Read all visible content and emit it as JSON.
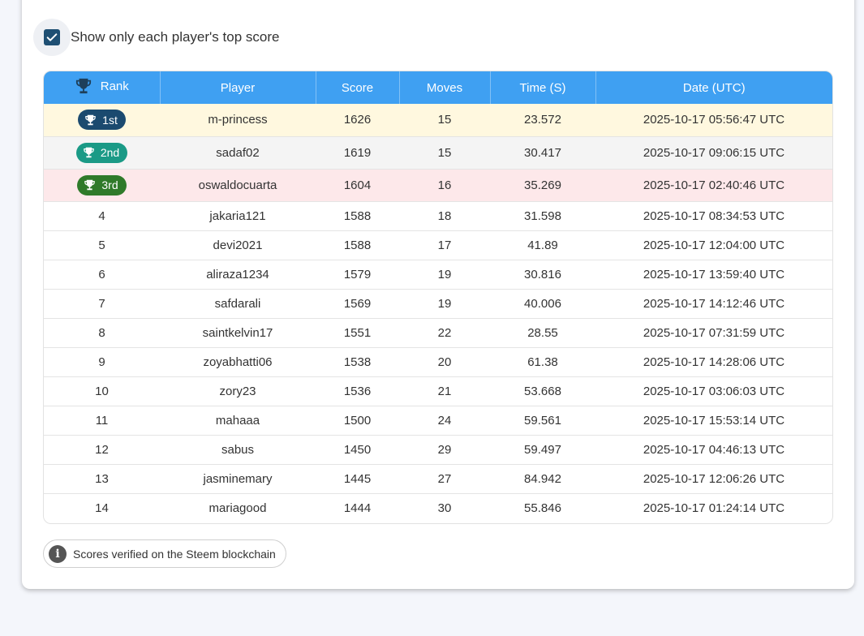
{
  "filter": {
    "top_score_only_label": "Show only each player's top score",
    "checked": true
  },
  "table": {
    "headers": [
      "Rank",
      "Player",
      "Score",
      "Moves",
      "Time (S)",
      "Date (UTC)"
    ],
    "rows": [
      {
        "rank": "1st",
        "player": "m-princess",
        "score": "1626",
        "moves": "15",
        "time": "23.572",
        "date": "2025-10-17 05:56:47 UTC"
      },
      {
        "rank": "2nd",
        "player": "sadaf02",
        "score": "1619",
        "moves": "15",
        "time": "30.417",
        "date": "2025-10-17 09:06:15 UTC"
      },
      {
        "rank": "3rd",
        "player": "oswaldocuarta",
        "score": "1604",
        "moves": "16",
        "time": "35.269",
        "date": "2025-10-17 02:40:46 UTC"
      },
      {
        "rank": "4",
        "player": "jakaria121",
        "score": "1588",
        "moves": "18",
        "time": "31.598",
        "date": "2025-10-17 08:34:53 UTC"
      },
      {
        "rank": "5",
        "player": "devi2021",
        "score": "1588",
        "moves": "17",
        "time": "41.89",
        "date": "2025-10-17 12:04:00 UTC"
      },
      {
        "rank": "6",
        "player": "aliraza1234",
        "score": "1579",
        "moves": "19",
        "time": "30.816",
        "date": "2025-10-17 13:59:40 UTC"
      },
      {
        "rank": "7",
        "player": "safdarali",
        "score": "1569",
        "moves": "19",
        "time": "40.006",
        "date": "2025-10-17 14:12:46 UTC"
      },
      {
        "rank": "8",
        "player": "saintkelvin17",
        "score": "1551",
        "moves": "22",
        "time": "28.55",
        "date": "2025-10-17 07:31:59 UTC"
      },
      {
        "rank": "9",
        "player": "zoyabhatti06",
        "score": "1538",
        "moves": "20",
        "time": "61.38",
        "date": "2025-10-17 14:28:06 UTC"
      },
      {
        "rank": "10",
        "player": "zory23",
        "score": "1536",
        "moves": "21",
        "time": "53.668",
        "date": "2025-10-17 03:06:03 UTC"
      },
      {
        "rank": "11",
        "player": "mahaaa",
        "score": "1500",
        "moves": "24",
        "time": "59.561",
        "date": "2025-10-17 15:53:14 UTC"
      },
      {
        "rank": "12",
        "player": "sabus",
        "score": "1450",
        "moves": "29",
        "time": "59.497",
        "date": "2025-10-17 04:46:13 UTC"
      },
      {
        "rank": "13",
        "player": "jasminemary",
        "score": "1445",
        "moves": "27",
        "time": "84.942",
        "date": "2025-10-17 12:06:26 UTC"
      },
      {
        "rank": "14",
        "player": "mariagood",
        "score": "1444",
        "moves": "30",
        "time": "55.846",
        "date": "2025-10-17 01:24:14 UTC"
      }
    ]
  },
  "badge_colors": {
    "gold": "#1b4a6f",
    "silver": "#1a9a86",
    "bronze": "#2f7a2a"
  },
  "header_color": "#3fa0f2",
  "footer": {
    "info_text": "Scores verified on the Steem blockchain"
  }
}
